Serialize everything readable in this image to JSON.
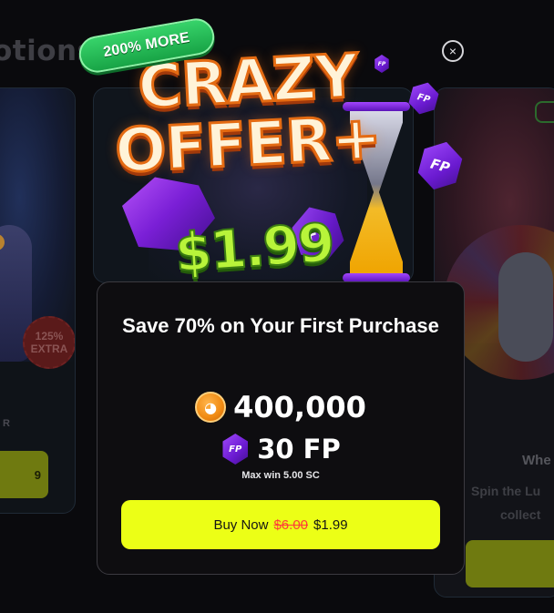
{
  "background": {
    "page_title_fragment": "otions",
    "left_card": {
      "extra_badge": "125%\nEXTRA",
      "small_text": "R",
      "button_fragment": "9"
    },
    "right_card": {
      "title_fragment": "Whe",
      "desc_line1": "Spin the Lu",
      "desc_line2": "collect"
    }
  },
  "modal": {
    "badge": "200% MORE",
    "headline_line1": "CRAZY",
    "headline_line2": "OFFER+",
    "promo_price": "$1.99",
    "fp_coin_label": "FP",
    "title": "Save 70% on Your First Purchase",
    "coins_amount": "400,000",
    "fp_amount": "30 FP",
    "max_win": "Max win 5.00 SC",
    "buy_button": {
      "label": "Buy Now",
      "old_price": "$6.00",
      "new_price": "$1.99"
    },
    "close_icon": "×"
  },
  "colors": {
    "accent_button": "#ecff16",
    "price_green": "#b8f43a",
    "headline_orange": "#e46b12",
    "badge_green": "#18a446",
    "fp_purple": "#6a1ad0",
    "old_price_red": "#ff3a3a"
  },
  "icons": [
    "close-icon",
    "coin-icon",
    "fp-coin-icon",
    "hourglass-icon",
    "crystal-icon"
  ]
}
